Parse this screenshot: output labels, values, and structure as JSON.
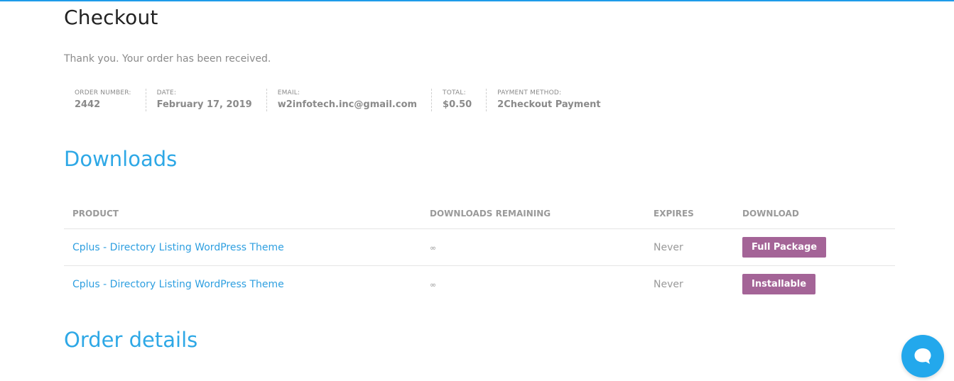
{
  "page": {
    "title": "Checkout",
    "thank_you": "Thank you. Your order has been received."
  },
  "order_overview": {
    "order_number": {
      "label": "ORDER NUMBER:",
      "value": "2442"
    },
    "date": {
      "label": "DATE:",
      "value": "February 17, 2019"
    },
    "email": {
      "label": "EMAIL:",
      "value": "w2infotech.inc@gmail.com"
    },
    "total": {
      "label": "TOTAL:",
      "value": "$0.50"
    },
    "payment_method": {
      "label": "PAYMENT METHOD:",
      "value": "2Checkout Payment"
    }
  },
  "downloads": {
    "title": "Downloads",
    "columns": [
      "PRODUCT",
      "DOWNLOADS REMAINING",
      "EXPIRES",
      "DOWNLOAD"
    ],
    "rows": [
      {
        "product": "Cplus - Directory Listing WordPress Theme",
        "remaining": "∞",
        "expires": "Never",
        "button": "Full Package"
      },
      {
        "product": "Cplus - Directory Listing WordPress Theme",
        "remaining": "∞",
        "expires": "Never",
        "button": "Installable"
      }
    ]
  },
  "order_details": {
    "title": "Order details"
  },
  "chat": {
    "icon": "chat-bubble-icon"
  },
  "colors": {
    "accent": "#2ea8e6",
    "button": "#a46497",
    "top_bar": "#1e9be9",
    "chat": "#23a8ec"
  }
}
